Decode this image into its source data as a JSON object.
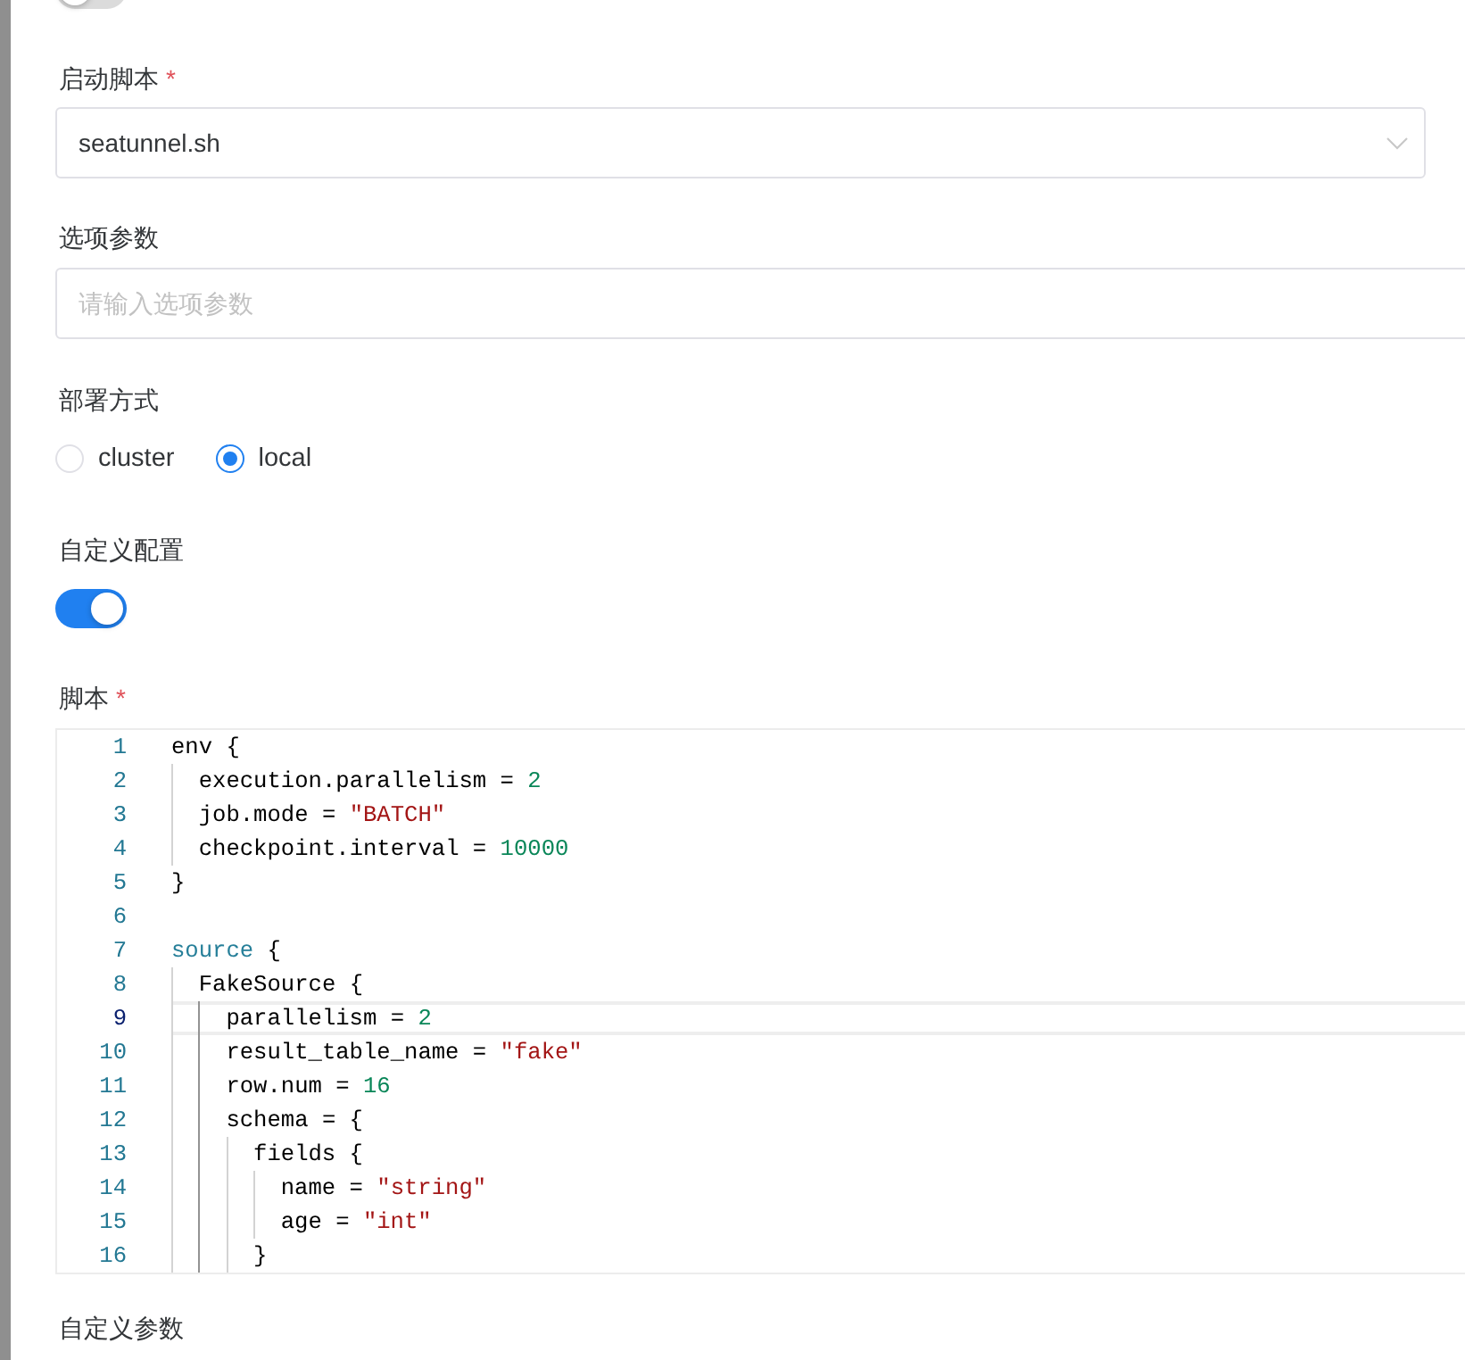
{
  "form": {
    "items": [
      {
        "kind": "switch",
        "on": false
      },
      {
        "kind": "select",
        "label": "启动脚本",
        "required_mark": "*",
        "value": "seatunnel.sh"
      },
      {
        "kind": "input",
        "label": "选项参数",
        "placeholder": "请输入选项参数"
      },
      {
        "kind": "radio",
        "label": "部署方式",
        "options": [
          {
            "label": "cluster",
            "selected": false
          },
          {
            "label": "local",
            "selected": true
          }
        ]
      },
      {
        "kind": "switch",
        "label": "自定义配置",
        "on": true
      },
      {
        "kind": "editor",
        "label": "脚本",
        "required_mark": "*",
        "lines": [
          {
            "number": "1",
            "current": false,
            "tokens": [
              {
                "kind": "plain",
                "text": "env {"
              }
            ]
          },
          {
            "number": "2",
            "current": false,
            "tokens": [
              {
                "kind": "plain",
                "text": "  execution.parallelism = "
              },
              {
                "kind": "number",
                "text": "2"
              }
            ]
          },
          {
            "number": "3",
            "current": false,
            "tokens": [
              {
                "kind": "plain",
                "text": "  job.mode = "
              },
              {
                "kind": "string",
                "text": "\"BATCH\""
              }
            ]
          },
          {
            "number": "4",
            "current": false,
            "tokens": [
              {
                "kind": "plain",
                "text": "  checkpoint.interval = "
              },
              {
                "kind": "number",
                "text": "10000"
              }
            ]
          },
          {
            "number": "5",
            "current": false,
            "tokens": [
              {
                "kind": "plain",
                "text": "}"
              }
            ]
          },
          {
            "number": "6",
            "current": false
          },
          {
            "number": "7",
            "current": false,
            "tokens": [
              {
                "kind": "keyword",
                "text": "source"
              },
              {
                "kind": "plain",
                "text": " {"
              }
            ]
          },
          {
            "number": "8",
            "current": false,
            "tokens": [
              {
                "kind": "plain",
                "text": "  FakeSource {"
              }
            ]
          },
          {
            "number": "9",
            "current": true,
            "tokens": [
              {
                "kind": "plain",
                "text": "    parallelism = "
              },
              {
                "kind": "number",
                "text": "2"
              }
            ]
          },
          {
            "number": "10",
            "current": false,
            "tokens": [
              {
                "kind": "plain",
                "text": "    result_table_name = "
              },
              {
                "kind": "string",
                "text": "\"fake\""
              }
            ]
          },
          {
            "number": "11",
            "current": false,
            "tokens": [
              {
                "kind": "plain",
                "text": "    row.num = "
              },
              {
                "kind": "number",
                "text": "16"
              }
            ]
          },
          {
            "number": "12",
            "current": false,
            "tokens": [
              {
                "kind": "plain",
                "text": "    schema = {"
              }
            ]
          },
          {
            "number": "13",
            "current": false,
            "tokens": [
              {
                "kind": "plain",
                "text": "      fields {"
              }
            ]
          },
          {
            "number": "14",
            "current": false,
            "tokens": [
              {
                "kind": "plain",
                "text": "        name = "
              },
              {
                "kind": "string",
                "text": "\"string\""
              }
            ]
          },
          {
            "number": "15",
            "current": false,
            "tokens": [
              {
                "kind": "plain",
                "text": "        age = "
              },
              {
                "kind": "string",
                "text": "\"int\""
              }
            ]
          },
          {
            "number": "16",
            "current": false,
            "tokens": [
              {
                "kind": "plain",
                "text": "      }"
              }
            ]
          }
        ]
      },
      {
        "kind": "label",
        "label": "自定义参数"
      }
    ]
  }
}
